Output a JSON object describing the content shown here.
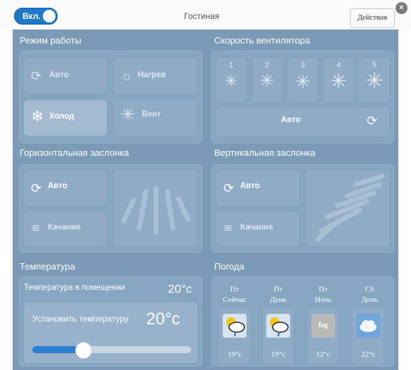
{
  "header": {
    "power_label": "Вкл.",
    "title": "Гостиная",
    "actions_label": "Действия",
    "close_glyph": "×"
  },
  "mode": {
    "title": "Режим работы",
    "buttons": [
      {
        "label": "Авто",
        "icon": "auto-cycle-icon"
      },
      {
        "label": "Нагрев",
        "icon": "sun-icon"
      },
      {
        "label": "Холод",
        "icon": "snowflake-icon",
        "selected": true
      },
      {
        "label": "Вент",
        "icon": "fan-icon"
      }
    ]
  },
  "fan_speed": {
    "title": "Скорость вентилятора",
    "levels": [
      "1",
      "2",
      "3",
      "4",
      "5"
    ],
    "auto_label": "Авто"
  },
  "horizontal_louver": {
    "title": "Горизонтальная заслонка",
    "auto_label": "Авто",
    "swing_label": "Качание"
  },
  "vertical_louver": {
    "title": "Вертикальная заслонка",
    "auto_label": "Авто",
    "swing_label": "Качание"
  },
  "temperature": {
    "title": "Температура",
    "room_label": "Температура в помещении",
    "room_value": "20°c",
    "set_label": "Установить температуру",
    "set_value": "20°c",
    "slider_fraction": 0.32
  },
  "weather": {
    "title": "Погода",
    "days": [
      {
        "day": "Пт",
        "period": "Сейчас",
        "icon": "sun-cloud-rain-icon",
        "temp": "19°c"
      },
      {
        "day": "Пт",
        "period": "День",
        "icon": "sun-cloud-rain-icon",
        "temp": "19°c"
      },
      {
        "day": "Пт",
        "period": "Ночь",
        "icon": "fog-icon",
        "icon_text": "fog",
        "temp": "12°c"
      },
      {
        "day": "Сб",
        "period": "День",
        "icon": "cloud-icon",
        "temp": "22°c"
      }
    ]
  },
  "colors": {
    "accent": "#1f78c9",
    "panel": "#7b9ab8",
    "box": "#86a5c1",
    "button": "#90abc5"
  }
}
